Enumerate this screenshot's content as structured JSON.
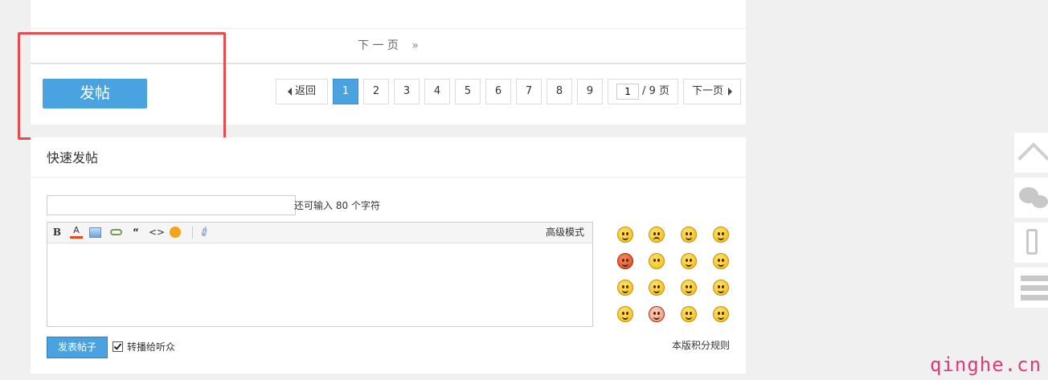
{
  "pager_strip": {
    "next_page": "下 一 页",
    "arrows": "»"
  },
  "post_button": "发帖",
  "pagination": {
    "prev": "返回",
    "pages": [
      "1",
      "2",
      "3",
      "4",
      "5",
      "6",
      "7",
      "8",
      "9"
    ],
    "current": "1",
    "jump_value": "1",
    "total": "/ 9 页",
    "next": "下一页"
  },
  "quick_post": {
    "title": "快速发帖",
    "remain_prefix": "还可输入",
    "remain_count": "80",
    "remain_suffix": "个字符",
    "advanced_mode": "高级模式",
    "submit": "发表帖子",
    "broadcast": "转播给听众",
    "rules": "本版积分规则",
    "toolbar": {
      "bold": "B",
      "color": "A",
      "quote": "“",
      "code": "<>"
    }
  },
  "watermark": "qinghe.cn",
  "colors": {
    "accent": "#49a3e0",
    "highlight": "#e84b4b",
    "watermark": "#e03a7e"
  }
}
